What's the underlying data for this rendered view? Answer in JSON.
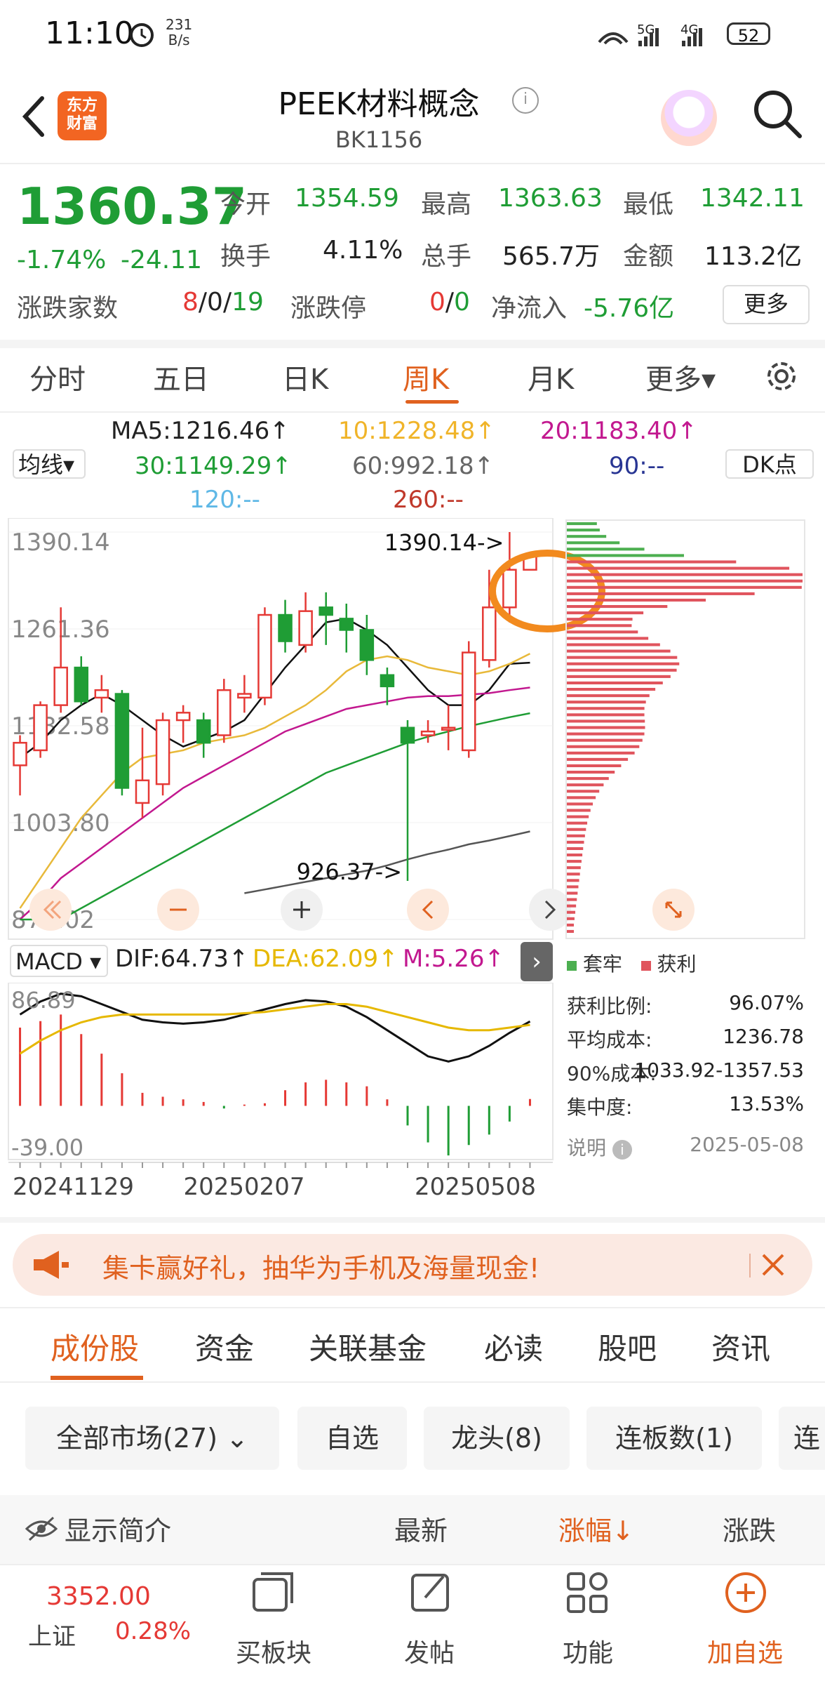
{
  "status_bar": {
    "time": "11:10",
    "net_speed_value": "231",
    "net_speed_unit": "B/s",
    "battery": "52"
  },
  "header": {
    "title": "PEEK材料概念",
    "code": "BK1156",
    "logo_text_1": "东方",
    "logo_text_2": "财富"
  },
  "quote": {
    "price": "1360.37",
    "change_pct": "-1.74%",
    "change_abs": "-24.11",
    "open_label": "今开",
    "open": "1354.59",
    "high_label": "最高",
    "high": "1363.63",
    "low_label": "最低",
    "low": "1342.11",
    "turnover_label": "换手",
    "turnover": "4.11%",
    "volume_label": "总手",
    "volume": "565.7万",
    "amount_label": "金额",
    "amount": "113.2亿",
    "breadth_label": "涨跌家数",
    "breadth_up": "8",
    "breadth_sep": "/0/",
    "breadth_down": "19",
    "limit_label": "涨跌停",
    "limit_up": "0",
    "limit_sep": "/",
    "limit_down": "0",
    "netflow_label": "净流入",
    "netflow": "-5.76亿",
    "more_label": "更多"
  },
  "period_tabs": [
    "分时",
    "五日",
    "日K",
    "周K",
    "月K",
    "更多▾"
  ],
  "ma": {
    "select_label": "均线▾",
    "ma5": "MA5:1216.46↑",
    "ma10": "10:1228.48↑",
    "ma20": "20:1183.40↑",
    "ma30": "30:1149.29↑",
    "ma60": "60:992.18↑",
    "ma90": "90:--",
    "ma120": "120:--",
    "ma260": "260:--",
    "dk_label": "DK点"
  },
  "chart_data": [
    {
      "type": "candlestick",
      "axis_labels": [
        "1390.14",
        "1261.36",
        "1132.58",
        "1003.80",
        "875.02"
      ],
      "ylim": [
        875.02,
        1390.14
      ],
      "high_marker": "1390.14->",
      "low_marker": "926.37->",
      "x_labels": [
        "20241129",
        "20250207",
        "20250508"
      ],
      "candles": [
        [
          1080,
          1110,
          1040,
          1120
        ],
        [
          1100,
          1160,
          1090,
          1165
        ],
        [
          1160,
          1210,
          1150,
          1290
        ],
        [
          1210,
          1165,
          1160,
          1225
        ],
        [
          1170,
          1180,
          1150,
          1200
        ],
        [
          1175,
          1050,
          1040,
          1180
        ],
        [
          1030,
          1060,
          1010,
          1130
        ],
        [
          1055,
          1140,
          1040,
          1150
        ],
        [
          1140,
          1150,
          1110,
          1160
        ],
        [
          1140,
          1110,
          1090,
          1150
        ],
        [
          1120,
          1180,
          1110,
          1195
        ],
        [
          1170,
          1175,
          1150,
          1200
        ],
        [
          1170,
          1280,
          1160,
          1290
        ],
        [
          1280,
          1245,
          1230,
          1300
        ],
        [
          1240,
          1285,
          1230,
          1310
        ],
        [
          1290,
          1280,
          1240,
          1310
        ],
        [
          1275,
          1260,
          1230,
          1295
        ],
        [
          1260,
          1220,
          1200,
          1280
        ],
        [
          1200,
          1185,
          1160,
          1210
        ],
        [
          1130,
          1110,
          926.37,
          1140
        ],
        [
          1120,
          1125,
          1110,
          1140
        ],
        [
          1130,
          1130,
          1100,
          1160
        ],
        [
          1100,
          1230,
          1090,
          1245
        ],
        [
          1220,
          1290,
          1210,
          1340
        ],
        [
          1290,
          1340,
          1270,
          1390.14
        ],
        [
          1340,
          1360.37,
          1340,
          1363.63
        ]
      ],
      "series": [
        {
          "name": "MA5",
          "values": [
            1090,
            1110,
            1140,
            1160,
            1175,
            1160,
            1140,
            1120,
            1105,
            1115,
            1125,
            1140,
            1175,
            1210,
            1240,
            1270,
            1275,
            1260,
            1240,
            1210,
            1180,
            1160,
            1160,
            1180,
            1215,
            1216.46
          ]
        },
        {
          "name": "10",
          "values": [
            890,
            930,
            970,
            1010,
            1040,
            1070,
            1090,
            1095,
            1100,
            1110,
            1115,
            1120,
            1130,
            1145,
            1160,
            1180,
            1205,
            1220,
            1225,
            1220,
            1210,
            1205,
            1200,
            1205,
            1215,
            1228.48
          ]
        },
        {
          "name": "20",
          "values": [
            870,
            900,
            930,
            950,
            970,
            990,
            1010,
            1030,
            1050,
            1065,
            1080,
            1095,
            1110,
            1125,
            1135,
            1145,
            1155,
            1160,
            1165,
            1170,
            1172,
            1172,
            1174,
            1176,
            1180,
            1183.4
          ]
        },
        {
          "name": "30",
          "values": [
            850,
            860,
            875,
            890,
            905,
            920,
            935,
            950,
            965,
            980,
            995,
            1010,
            1025,
            1040,
            1055,
            1070,
            1080,
            1090,
            1100,
            1110,
            1118,
            1125,
            1132,
            1138,
            1144,
            1149.29
          ]
        },
        {
          "name": "60",
          "values": [
            null,
            null,
            null,
            null,
            null,
            null,
            null,
            null,
            null,
            null,
            null,
            910,
            915,
            920,
            925,
            930,
            935,
            940,
            947,
            955,
            962,
            968,
            975,
            980,
            986,
            992.18
          ]
        }
      ]
    },
    {
      "type": "bar",
      "indicator": "MACD",
      "axis_labels": [
        "86.89",
        "-39.00"
      ],
      "ylim": [
        -39.0,
        86.89
      ],
      "dif_label": "DIF:64.73↑",
      "dea_label": "DEA:62.09↑",
      "m_label": "M:5.26↑",
      "macd": [
        60,
        65,
        70,
        55,
        40,
        25,
        10,
        7,
        5,
        3,
        -2,
        1,
        2,
        12,
        18,
        20,
        18,
        15,
        5,
        -15,
        -28,
        -38,
        -30,
        -22,
        -12,
        5.26
      ],
      "dif": [
        70,
        80,
        86,
        84,
        78,
        72,
        66,
        64,
        63,
        64,
        66,
        70,
        74,
        78,
        81,
        80,
        76,
        68,
        58,
        48,
        38,
        34,
        38,
        46,
        56,
        64.73
      ],
      "dea": [
        40,
        50,
        58,
        64,
        68,
        70,
        70,
        70,
        70,
        70,
        70,
        71,
        72,
        74,
        76,
        78,
        78,
        76,
        72,
        68,
        64,
        60,
        58,
        58,
        60,
        62.09
      ]
    },
    {
      "type": "bar",
      "name": "chip-distribution",
      "legend": [
        "套牢",
        "获利"
      ],
      "colors": {
        "trapped": "#4caf50",
        "profit": "#e0545d"
      },
      "rows": 65,
      "note": "horizontal chip bars, top rows trapped (green), remainder profit (red)"
    }
  ],
  "chip_stats": {
    "legend_trapped": "套牢",
    "legend_profit": "获利",
    "rows": [
      {
        "label": "获利比例:",
        "value": "96.07%"
      },
      {
        "label": "平均成本:",
        "value": "1236.78"
      },
      {
        "label": "90%成本:",
        "value": "1033.92-1357.53"
      },
      {
        "label": "集中度:",
        "value": "13.53%"
      }
    ],
    "note_label": "说明",
    "date": "2025-05-08"
  },
  "banner": {
    "text": "集卡赢好礼，抽华为手机及海量现金!"
  },
  "section_tabs": [
    "成份股",
    "资金",
    "关联基金",
    "必读",
    "股吧",
    "资讯"
  ],
  "filters": [
    "全部市场(27)",
    "自选",
    "龙头(8)",
    "连板数(1)",
    "连"
  ],
  "list_header": {
    "intro": "显示简介",
    "latest": "最新",
    "change_pct": "涨幅↓",
    "change": "涨跌"
  },
  "bottom_nav": {
    "index_value": "3352.00",
    "index_name": "上证",
    "index_pct": "0.28%",
    "items": [
      "买板块",
      "发帖",
      "功能",
      "加自选"
    ]
  },
  "colors": {
    "up": "#e53935",
    "down": "#1f9d35",
    "accent": "#e0611f"
  }
}
